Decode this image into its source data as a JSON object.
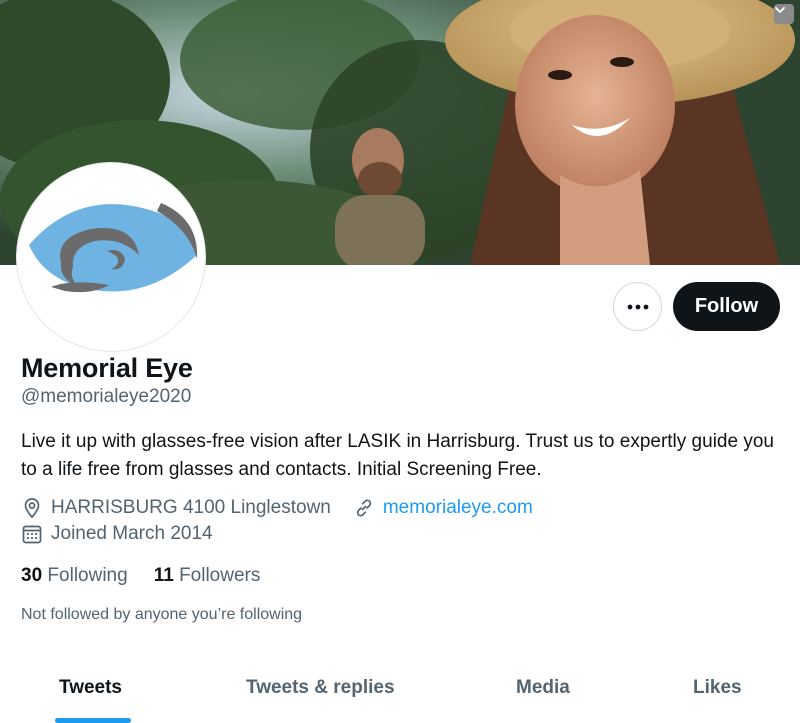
{
  "profile": {
    "name": "Memorial Eye",
    "handle": "@memorialeye2020",
    "bio": "Live it up with glasses-free vision after LASIK in Harrisburg. Trust us to expertly guide you to a life free from glasses and contacts. Initial Screening Free.",
    "location": "HARRISBURG 4100 Linglestown",
    "website": "memorialeye.com",
    "joined": "Joined March 2014",
    "following_count": "30",
    "following_label": "Following",
    "followers_count": "11",
    "followers_label": "Followers",
    "not_followed_text": "Not followed by anyone you’re following"
  },
  "actions": {
    "follow_label": "Follow",
    "more_label": "•••"
  },
  "tabs": [
    {
      "label": "Tweets",
      "active": true
    },
    {
      "label": "Tweets & replies",
      "active": false
    },
    {
      "label": "Media",
      "active": false
    },
    {
      "label": "Likes",
      "active": false
    }
  ],
  "icons": {
    "location": "location-pin-icon",
    "link": "link-icon",
    "calendar": "calendar-icon",
    "more": "more-options-icon",
    "chevron": "chevron-down-icon"
  },
  "colors": {
    "accent": "#1d9bf0",
    "follow_bg": "#0f1419",
    "secondary_text": "#536471",
    "logo_blue": "#6fb3e2",
    "logo_gray": "#6b6b6b"
  }
}
